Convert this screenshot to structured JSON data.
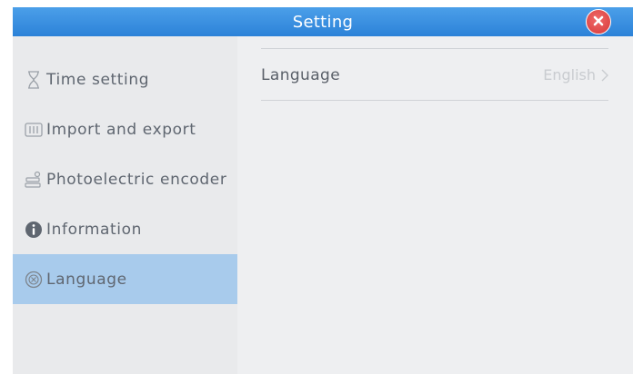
{
  "window": {
    "title": "Setting",
    "close_icon": "close-icon"
  },
  "sidebar": {
    "items": [
      {
        "label": "Time setting",
        "icon": "hourglass-icon",
        "active": false
      },
      {
        "label": "Import and export",
        "icon": "import-export-icon",
        "active": false
      },
      {
        "label": "Photoelectric encoder",
        "icon": "encoder-icon",
        "active": false
      },
      {
        "label": "Information",
        "icon": "info-icon",
        "active": false
      },
      {
        "label": "Language",
        "icon": "language-icon",
        "active": true
      }
    ]
  },
  "main": {
    "row": {
      "label": "Language",
      "value": "English",
      "icon": "chevron-right-icon"
    }
  },
  "colors": {
    "titlebar": "#2c82d8",
    "close": "#d63838",
    "active_item": "#a8cbec",
    "background": "#ecedef"
  }
}
